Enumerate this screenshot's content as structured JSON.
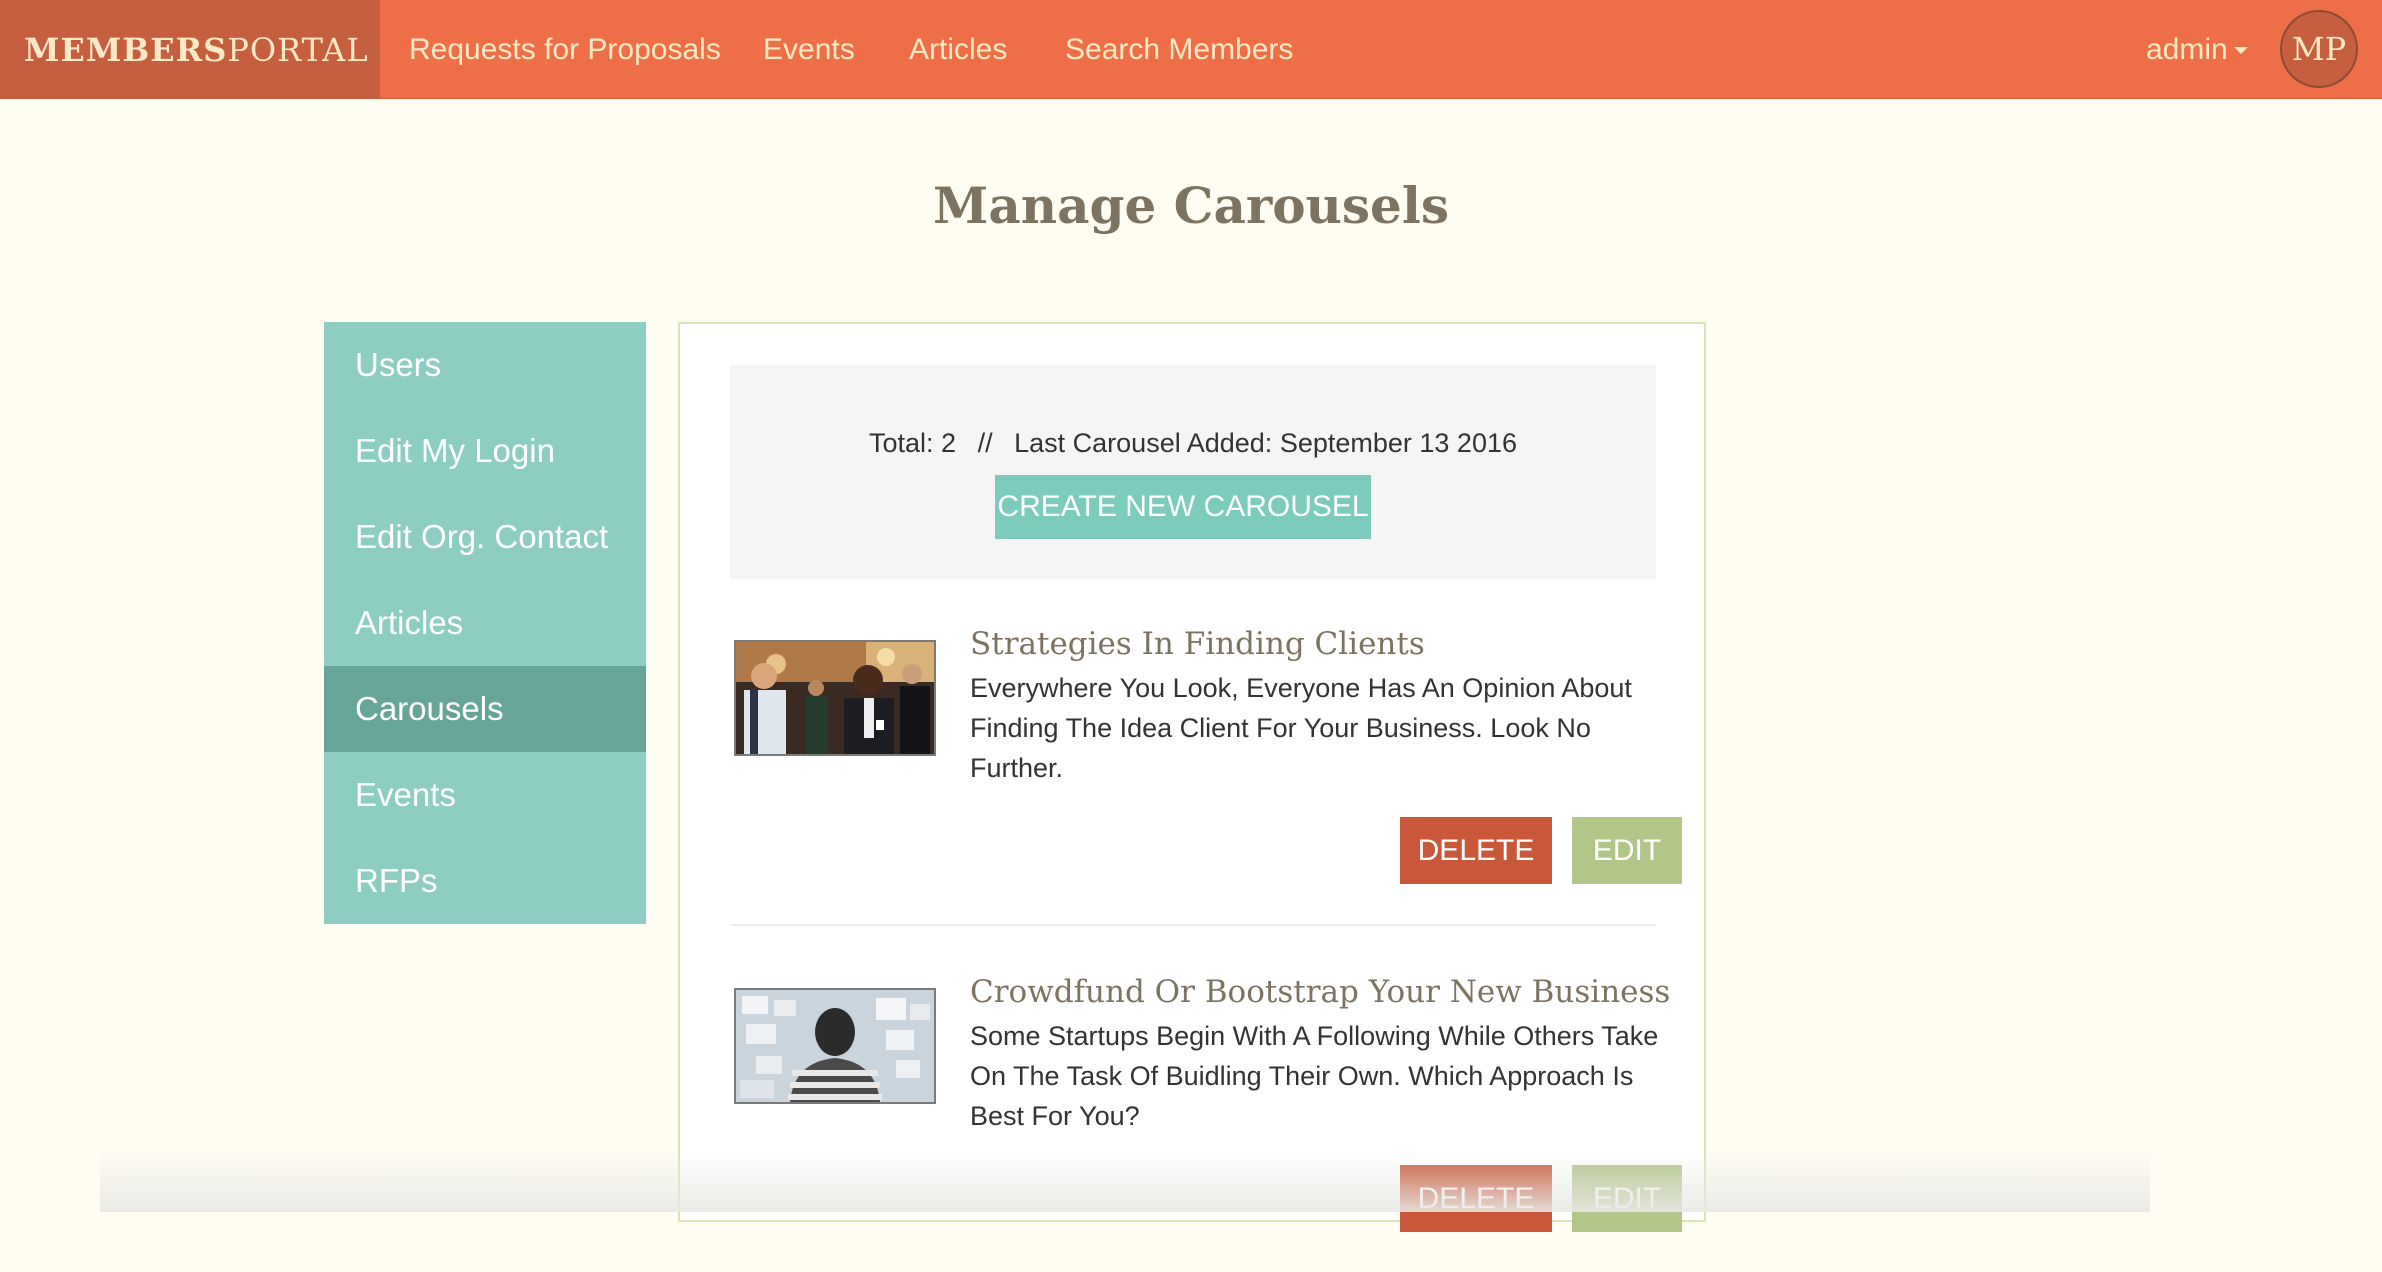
{
  "nav": {
    "brand_bold": "MEMBERS",
    "brand_rest": "PORTAL",
    "links": [
      {
        "label": "Requests for Proposals"
      },
      {
        "label": "Events"
      },
      {
        "label": "Articles"
      },
      {
        "label": "Search Members"
      }
    ],
    "user_label": "admin",
    "avatar_initials": "MP"
  },
  "page": {
    "title": "Manage Carousels"
  },
  "sidebar": {
    "items": [
      {
        "label": "Users"
      },
      {
        "label": "Edit My Login"
      },
      {
        "label": "Edit Org. Contact"
      },
      {
        "label": "Articles"
      },
      {
        "label": "Carousels",
        "active": true
      },
      {
        "label": "Events"
      },
      {
        "label": "RFPs"
      }
    ]
  },
  "summary": {
    "total_label": "Total:",
    "total_value": "2",
    "separator": "//",
    "last_added_label": "Last Carousel Added:",
    "last_added_value": "September 13 2016",
    "create_button": "CREATE NEW CAROUSEL"
  },
  "carousels": [
    {
      "title": "Strategies In Finding Clients",
      "description_lines": [
        "Everywhere You Look, Everyone Has An Opinion About",
        "Finding The Idea Client For Your Business. Look No",
        "Further."
      ],
      "delete_label": "DELETE",
      "edit_label": "EDIT"
    },
    {
      "title": "Crowdfund Or Bootstrap Your New Business",
      "description_lines": [
        "Some Startups Begin With A Following While Others Take",
        "On The Task Of Buidling Their Own. Which Approach Is",
        "Best For You?"
      ],
      "delete_label": "DELETE",
      "edit_label": "EDIT"
    }
  ],
  "colors": {
    "nav_bg": "#ee6f47",
    "brand_bg": "#c55f3f",
    "sidebar_bg": "#8ecdc1",
    "sidebar_active": "#67a599",
    "create_button": "#7ccbbd",
    "delete_button": "#c9583a",
    "edit_button": "#b3c68a"
  }
}
